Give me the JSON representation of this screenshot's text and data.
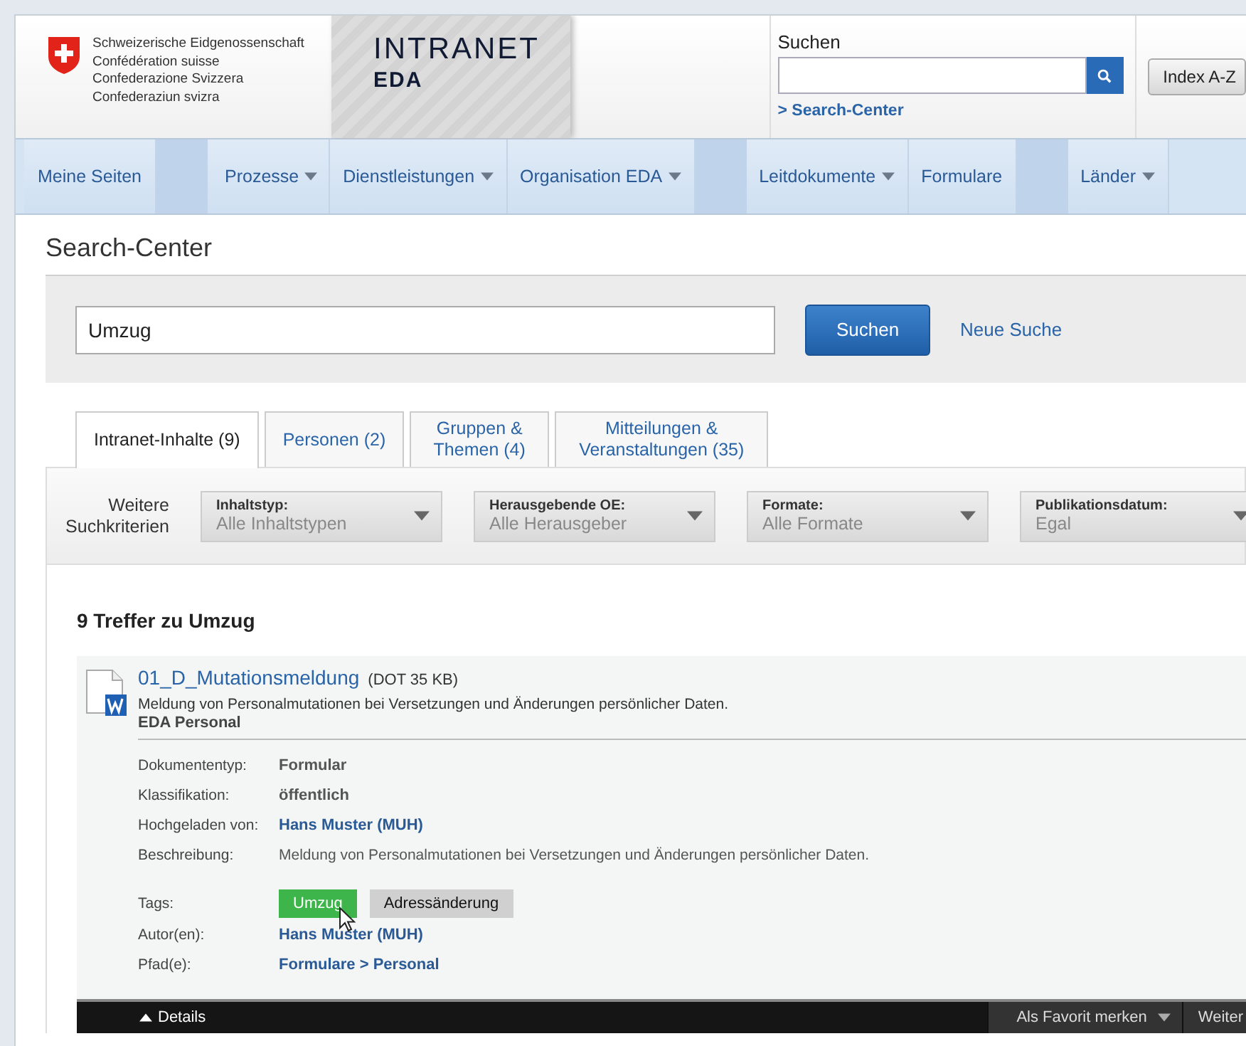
{
  "header": {
    "logo_lines": [
      "Schweizerische Eidgenossenschaft",
      "Confédération suisse",
      "Confederazione Svizzera",
      "Confederaziun svizra"
    ],
    "brand_title": "INTRANET",
    "brand_subtitle": "EDA",
    "search": {
      "label": "Suchen",
      "link": "> Search-Center"
    },
    "index_button": "Index A-Z"
  },
  "nav": [
    {
      "kind": "item",
      "label": "Meine Seiten",
      "has_menu": false
    },
    {
      "kind": "spacer"
    },
    {
      "kind": "item",
      "label": "Prozesse",
      "has_menu": true
    },
    {
      "kind": "item",
      "label": "Dienstleistungen",
      "has_menu": true
    },
    {
      "kind": "item",
      "label": "Organisation EDA",
      "has_menu": true
    },
    {
      "kind": "spacer"
    },
    {
      "kind": "item",
      "label": "Leitdokumente",
      "has_menu": true
    },
    {
      "kind": "item",
      "label": "Formulare",
      "has_menu": false
    },
    {
      "kind": "spacer"
    },
    {
      "kind": "item",
      "label": "Länder",
      "has_menu": true
    }
  ],
  "page_title": "Search-Center",
  "query": {
    "value": "Umzug",
    "button": "Suchen",
    "reset_link": "Neue Suche"
  },
  "tabs": [
    {
      "label": "Intranet-Inhalte (9)",
      "selected": true
    },
    {
      "label": "Personen (2)",
      "selected": false
    },
    {
      "label": "Gruppen & Themen (4)",
      "selected": false
    },
    {
      "label": "Mitteilungen & Veranstaltungen (35)",
      "selected": false
    }
  ],
  "filters": {
    "label": "Weitere Suchkriterien",
    "items": [
      {
        "label": "Inhaltstyp:",
        "value": "Alle Inhaltstypen"
      },
      {
        "label": "Herausgebende OE:",
        "value": "Alle Herausgeber"
      },
      {
        "label": "Formate:",
        "value": "Alle Formate"
      },
      {
        "label": "Publikationsdatum:",
        "value": "Egal"
      }
    ]
  },
  "results_heading": "9 Treffer zu Umzug",
  "results": [
    {
      "title": "01_D_Mutationsmeldung",
      "meta": "(DOT 35 KB)",
      "description": "Meldung von Personalmutationen bei Versetzungen und Änderungen persönlicher Daten.",
      "source": "EDA Personal",
      "details": [
        {
          "kind": "text",
          "label": "Dokumententyp:",
          "value": "Formular"
        },
        {
          "kind": "text",
          "label": "Klassifikation:",
          "value": "öffentlich"
        },
        {
          "kind": "link",
          "label": "Hochgeladen von:",
          "value": "Hans Muster (MUH)"
        },
        {
          "kind": "plain",
          "label": "Beschreibung:",
          "value": "Meldung von Personalmutationen bei Versetzungen und Änderungen persönlicher Daten."
        },
        {
          "kind": "tags",
          "label": "Tags:",
          "tags": [
            {
              "label": "Umzug",
              "highlighted": true
            },
            {
              "label": "Adressänderung",
              "highlighted": false
            }
          ]
        },
        {
          "kind": "link",
          "label": "Autor(en):",
          "value": "Hans Muster (MUH)"
        },
        {
          "kind": "link",
          "label": "Pfad(e):",
          "value": "Formulare > Personal"
        }
      ],
      "footer": {
        "toggle": "Details",
        "favorite": "Als Favorit merken",
        "more": "Weiter"
      }
    }
  ]
}
